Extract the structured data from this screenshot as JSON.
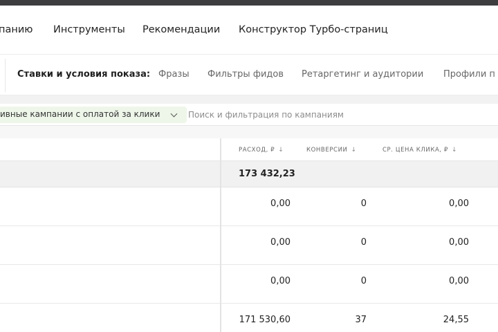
{
  "nav": {
    "items": [
      "панию",
      "Инструменты",
      "Рекомендации",
      "Конструктор Турбо-страниц"
    ]
  },
  "tabs": {
    "label": "Ставки и условия показа:",
    "items": [
      "Фразы",
      "Фильтры фидов",
      "Ретаргетинг и аудитории",
      "Профили п"
    ]
  },
  "filter": {
    "chip_label": "ивные кампании с оплатой за клики",
    "search_placeholder": "Поиск и фильтрация по кампаниям"
  },
  "table": {
    "headers": [
      {
        "label": "РАСХОД, ₽",
        "sort": "↓"
      },
      {
        "label": "КОНВЕРСИИ",
        "sort": "↓"
      },
      {
        "label": "СР. ЦЕНА КЛИКА, ₽",
        "sort": "↓"
      }
    ],
    "total": {
      "spend": "173 432,23"
    },
    "rows": [
      {
        "spend": "0,00",
        "conversions": "0",
        "avg_cpc": "0,00"
      },
      {
        "spend": "0,00",
        "conversions": "0",
        "avg_cpc": "0,00"
      },
      {
        "spend": "0,00",
        "conversions": "0",
        "avg_cpc": "0,00"
      },
      {
        "spend": "171 530,60",
        "conversions": "37",
        "avg_cpc": "24,55"
      }
    ]
  }
}
